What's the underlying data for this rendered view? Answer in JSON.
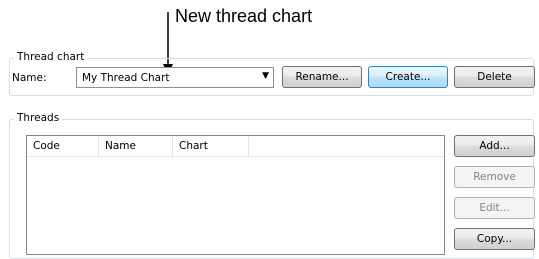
{
  "annotation": {
    "text": "New thread chart"
  },
  "thread_chart_group": {
    "title": "Thread chart",
    "name_label": "Name:",
    "name_value": "My Thread Chart",
    "rename_label": "Rename...",
    "create_label": "Create...",
    "delete_label": "Delete"
  },
  "threads_group": {
    "title": "Threads",
    "columns": [
      "Code",
      "Name",
      "Chart"
    ],
    "add_label": "Add...",
    "remove_label": "Remove",
    "edit_label": "Edit...",
    "copy_label": "Copy..."
  }
}
